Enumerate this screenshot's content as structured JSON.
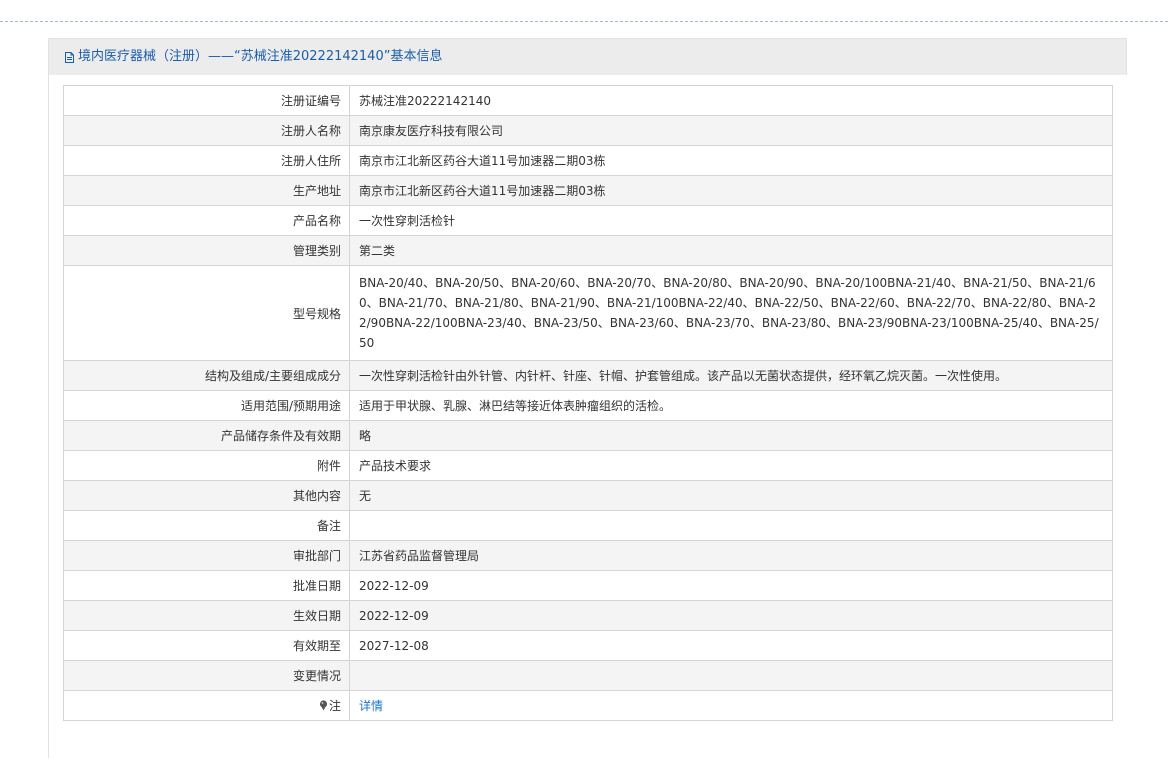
{
  "header": {
    "title": "境内医疗器械（注册）——“苏械注准20222142140”基本信息"
  },
  "rows": [
    {
      "label": "注册证编号",
      "value": "苏械注准20222142140"
    },
    {
      "label": "注册人名称",
      "value": "南京康友医疗科技有限公司"
    },
    {
      "label": "注册人住所",
      "value": "南京市江北新区药谷大道11号加速器二期03栋"
    },
    {
      "label": "生产地址",
      "value": "南京市江北新区药谷大道11号加速器二期03栋"
    },
    {
      "label": "产品名称",
      "value": "一次性穿刺活检针"
    },
    {
      "label": "管理类别",
      "value": "第二类"
    },
    {
      "label": "型号规格",
      "value": "BNA-20/40、BNA-20/50、BNA-20/60、BNA-20/70、BNA-20/80、BNA-20/90、BNA-20/100BNA-21/40、BNA-21/50、BNA-21/60、BNA-21/70、BNA-21/80、BNA-21/90、BNA-21/100BNA-22/40、BNA-22/50、BNA-22/60、BNA-22/70、BNA-22/80、BNA-22/90BNA-22/100BNA-23/40、BNA-23/50、BNA-23/60、BNA-23/70、BNA-23/80、BNA-23/90BNA-23/100BNA-25/40、BNA-25/50"
    },
    {
      "label": "结构及组成/主要组成成分",
      "value": "一次性穿刺活检针由外针管、内针杆、针座、针帽、护套管组成。该产品以无菌状态提供，经环氧乙烷灭菌。一次性使用。"
    },
    {
      "label": "适用范围/预期用途",
      "value": "适用于甲状腺、乳腺、淋巴结等接近体表肿瘤组织的活检。"
    },
    {
      "label": "产品储存条件及有效期",
      "value": "略"
    },
    {
      "label": "附件",
      "value": "产品技术要求"
    },
    {
      "label": "其他内容",
      "value": "无"
    },
    {
      "label": "备注",
      "value": ""
    },
    {
      "label": "审批部门",
      "value": "江苏省药品监督管理局"
    },
    {
      "label": "批准日期",
      "value": "2022-12-09"
    },
    {
      "label": "生效日期",
      "value": "2022-12-09"
    },
    {
      "label": "有效期至",
      "value": "2027-12-08"
    },
    {
      "label": "变更情况",
      "value": ""
    },
    {
      "label": "注",
      "value": "详情"
    }
  ],
  "colors": {
    "header_text": "#1a5ea8",
    "link": "#1a75c6",
    "border": "#d4d4d4",
    "stripe": "#f4f4f4"
  },
  "icons": {
    "header": "document-icon",
    "note": "pin-icon"
  }
}
